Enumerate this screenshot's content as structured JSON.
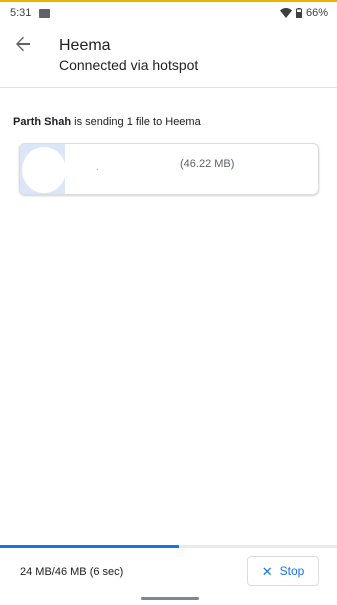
{
  "status_bar": {
    "time": "5:31",
    "battery": "66%"
  },
  "header": {
    "title": "Heema",
    "subtitle": "Connected via hotspot",
    "back_icon": "arrow-back-icon"
  },
  "transfer": {
    "sender": "Parth Shah",
    "message_rest": " is sending 1 file to Heema",
    "file": {
      "name": ".",
      "size": "(46.22 MB)",
      "progress": 0.15
    },
    "status_text": "24 MB/46 MB (6 sec)",
    "overall_progress": 0.53
  },
  "actions": {
    "stop_label": "Stop",
    "stop_icon": "close-icon"
  },
  "colors": {
    "accent": "#1a73e8",
    "top_accent": "#e8b400",
    "file_progress": "#dbe7f8"
  }
}
